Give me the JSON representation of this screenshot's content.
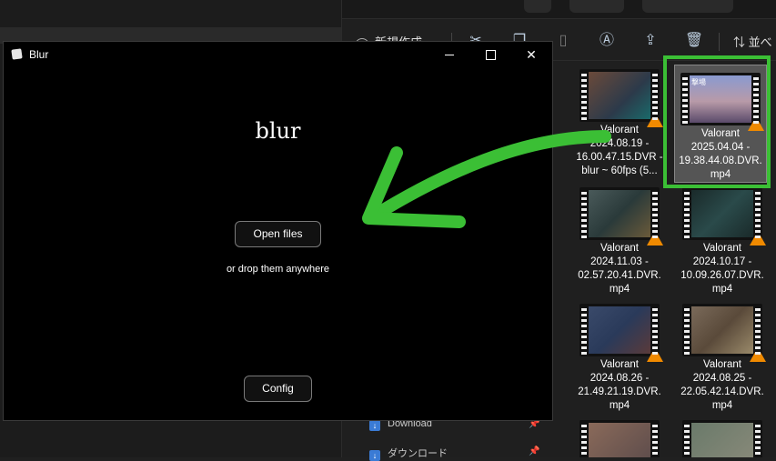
{
  "blur_window": {
    "title": "Blur",
    "heading": "blur",
    "open_files_label": "Open files",
    "drop_hint": "or drop them anywhere",
    "config_label": "Config"
  },
  "explorer": {
    "toolbar": {
      "new_label": "新規作成",
      "sort_label": "並べ"
    },
    "nav": [
      {
        "label": "Download"
      },
      {
        "label": "ダウンロード"
      }
    ],
    "files": [
      {
        "name": "Valorant 2024.08.19 - 16.00.47.15.DVR - blur ~ 60fps (5...",
        "lines": [
          "Valorant",
          "2024.08.19 -",
          "16.00.47.15.DVR -",
          "blur ~ 60fps (5..."
        ]
      },
      {
        "name": "Valorant 2025.04.04 - 19.38.44.08.DVR.mp4",
        "lines": [
          "Valorant",
          "2025.04.04 -",
          "19.38.44.08.DVR.",
          "mp4"
        ],
        "selected": true
      },
      {
        "name": "Valorant 2024.11.03 - 02.57.20.41.DVR.mp4",
        "lines": [
          "Valorant",
          "2024.11.03 -",
          "02.57.20.41.DVR.",
          "mp4"
        ]
      },
      {
        "name": "Valorant 2024.10.17 - 10.09.26.07.DVR.mp4",
        "lines": [
          "Valorant",
          "2024.10.17 -",
          "10.09.26.07.DVR.",
          "mp4"
        ]
      },
      {
        "name": "Valorant 2024.08.26 - 21.49.21.19.DVR.mp4",
        "lines": [
          "Valorant",
          "2024.08.26 -",
          "21.49.21.19.DVR.",
          "mp4"
        ]
      },
      {
        "name": "Valorant 2024.08.25 - 22.05.42.14.DVR.mp4",
        "lines": [
          "Valorant",
          "2024.08.25 -",
          "22.05.42.14.DVR.",
          "mp4"
        ]
      }
    ],
    "thumb_label_selected": "撃場"
  },
  "colors": {
    "highlight": "#3bbf35",
    "vlc_cone": "#f08a00"
  }
}
